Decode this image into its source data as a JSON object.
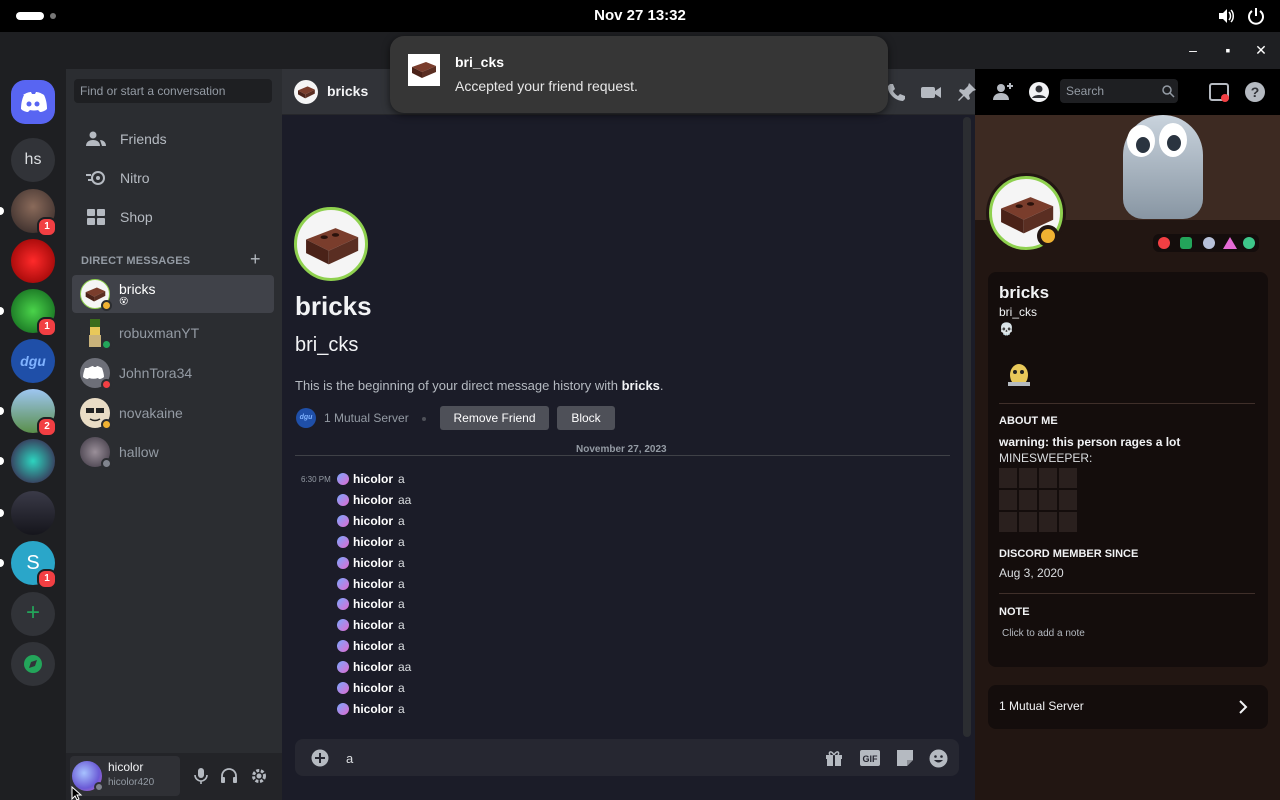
{
  "system": {
    "clock": "Nov 27  13:32"
  },
  "notification": {
    "title": "bri_cks",
    "body": "Accepted your friend request."
  },
  "servers": {
    "home_icon": "discord-icon",
    "hs_label": "hs",
    "badges": [
      "1",
      "1",
      "2",
      "1"
    ]
  },
  "dm_sidebar": {
    "search_placeholder": "Find or start a conversation",
    "nav": [
      {
        "label": "Friends",
        "icon": "friends-icon"
      },
      {
        "label": "Nitro",
        "icon": "nitro-icon"
      },
      {
        "label": "Shop",
        "icon": "shop-icon"
      }
    ],
    "section_title": "DIRECT MESSAGES",
    "dms": [
      {
        "name": "bricks"
      },
      {
        "name": "robuxmanYT"
      },
      {
        "name": "JohnTora34"
      },
      {
        "name": "novakaine"
      },
      {
        "name": "hallow"
      }
    ]
  },
  "user_panel": {
    "display_name": "hicolor",
    "username": "hicolor420"
  },
  "chat_header": {
    "name": "bricks",
    "search_placeholder": "Search"
  },
  "chat_intro": {
    "display_name": "bricks",
    "username": "bri_cks",
    "intro_prefix": "This is the beginning of your direct message history with ",
    "intro_name": "bricks",
    "intro_suffix": ".",
    "mutual": "1 Mutual Server",
    "remove_friend": "Remove Friend",
    "block": "Block",
    "date_divider": "November 27, 2023"
  },
  "messages": [
    {
      "time": "6:30 PM",
      "author": "hicolor",
      "text": "a"
    },
    {
      "time": "",
      "author": "hicolor",
      "text": "aa"
    },
    {
      "time": "",
      "author": "hicolor",
      "text": "a"
    },
    {
      "time": "",
      "author": "hicolor",
      "text": "a"
    },
    {
      "time": "",
      "author": "hicolor",
      "text": "a"
    },
    {
      "time": "",
      "author": "hicolor",
      "text": "a"
    },
    {
      "time": "",
      "author": "hicolor",
      "text": "a"
    },
    {
      "time": "",
      "author": "hicolor",
      "text": "a"
    },
    {
      "time": "",
      "author": "hicolor",
      "text": "a"
    },
    {
      "time": "",
      "author": "hicolor",
      "text": "aa"
    },
    {
      "time": "",
      "author": "hicolor",
      "text": "a"
    },
    {
      "time": "",
      "author": "hicolor",
      "text": "a"
    }
  ],
  "composer": {
    "value": "a"
  },
  "profile": {
    "display_name": "bricks",
    "username": "bri_cks",
    "status_emoji": "💀",
    "about_title": "ABOUT ME",
    "about_line1": "warning: this person rages a lot",
    "about_line2": "MINESWEEPER:",
    "member_since_title": "DISCORD MEMBER SINCE",
    "member_since": "Aug 3, 2020",
    "note_title": "NOTE",
    "note_placeholder": "Click to add a note",
    "mutual": "1 Mutual Server"
  },
  "colors": {
    "accent": "#5865f2",
    "online": "#23a55a",
    "dnd": "#f23f43",
    "idle": "#f0b232",
    "brick": "#5a2e22"
  }
}
